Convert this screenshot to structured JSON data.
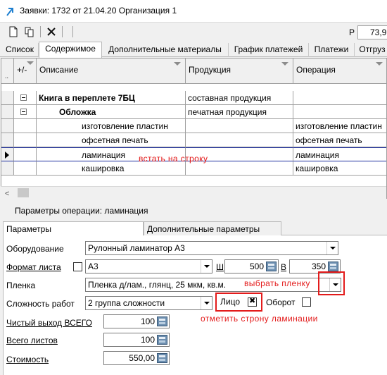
{
  "window": {
    "title": "Заявки: 1732 от 21.04.20  Организация 1",
    "icon": "arrow-icon"
  },
  "toolbar": {
    "buttons": [
      "new-document-icon",
      "copy-icon",
      "delete-icon"
    ],
    "right_label": "Р",
    "right_value": "73,9"
  },
  "tabs": [
    "Список",
    "Содержимое",
    "Дополнительные материалы",
    "График платежей",
    "Платежи",
    "Отгруз"
  ],
  "active_tab": "Содержимое",
  "grid": {
    "columns": [
      "+/-",
      "Описание",
      "Продукция",
      "Операция"
    ],
    "rows": [
      {
        "desc": "Книга в переплете 7БЦ",
        "product": "составная продукция",
        "operation": "",
        "bold": true,
        "expand": true
      },
      {
        "desc": "Обложка",
        "product": "печатная продукция",
        "operation": "",
        "bold": true,
        "expand": true
      },
      {
        "desc": "изготовление пластин",
        "product": "",
        "operation": "изготовление пластин"
      },
      {
        "desc": "офсетная печать",
        "product": "",
        "operation": "офсетная печать"
      },
      {
        "desc": "ламинация",
        "product": "",
        "operation": "ламинация",
        "selected": true
      },
      {
        "desc": "кашировка",
        "product": "",
        "operation": "кашировка"
      }
    ],
    "annotation": "встать на строку"
  },
  "panel": {
    "title": "Параметры операции: ламинация",
    "tabs": [
      "Параметры",
      "Дополнительные параметры"
    ],
    "equipment_label": "Оборудование",
    "equipment_value": "Рулонный ламинатор А3",
    "format_label": "Формат листа",
    "format_value": "А3",
    "w_label": "Ш",
    "w_value": "500",
    "h_label": "В",
    "h_value": "350",
    "film_label": "Пленка",
    "film_value": "Пленка д/лам., глянц, 25 мкм, кв.м.",
    "film_annotation": "выбрать пленку",
    "complexity_label": "Сложность работ",
    "complexity_value": "2 группа сложности",
    "face_label": "Лицо",
    "back_label": "Оборот",
    "face_checked": true,
    "back_checked": false,
    "side_annotation": "отметить строну ламинации",
    "net_output_label": "Чистый выход ВСЕГО",
    "net_output_value": "100",
    "total_sheets_label": "Всего листов",
    "total_sheets_value": "100",
    "cost_label": "Стоимость",
    "cost_value": "550,00"
  },
  "colors": {
    "annotation": "#e31b1b",
    "selection": "#1e2fa0"
  }
}
